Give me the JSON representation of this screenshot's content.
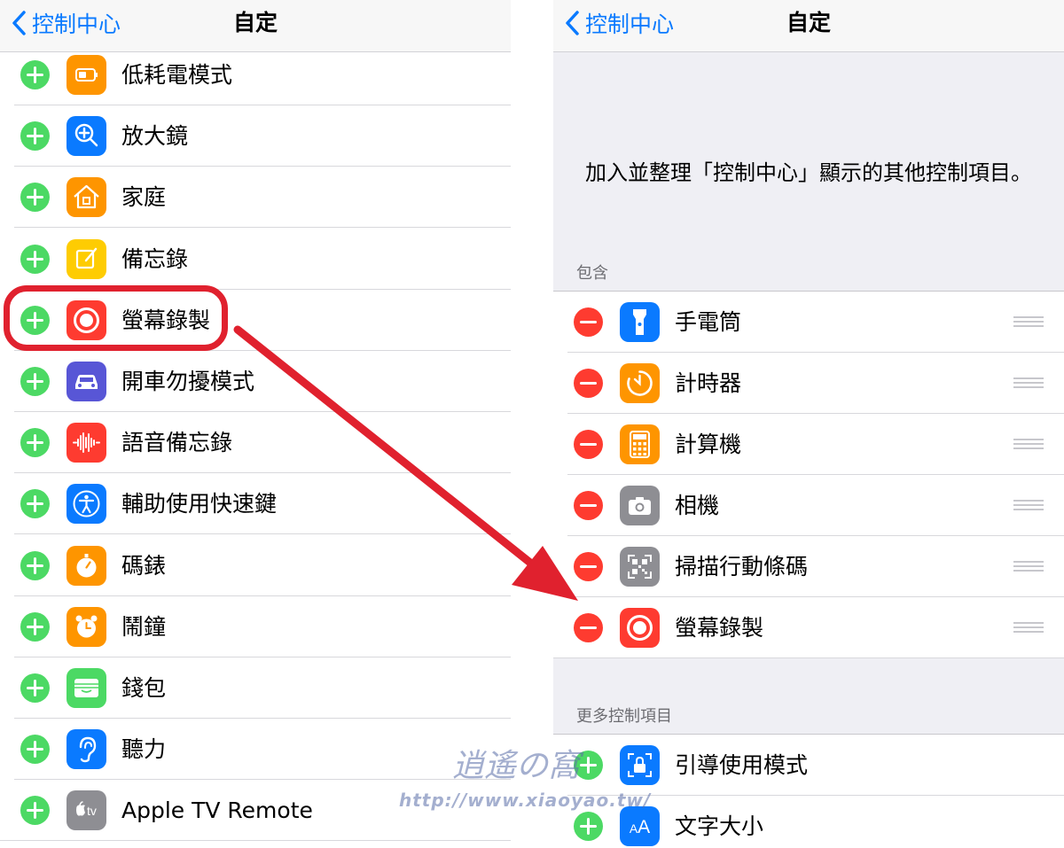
{
  "left": {
    "back_label": "控制中心",
    "title": "自定",
    "items": [
      {
        "label": "低耗電模式",
        "icon": "battery-icon",
        "color": "#fe9500"
      },
      {
        "label": "放大鏡",
        "icon": "magnifier-icon",
        "color": "#0a7aff"
      },
      {
        "label": "家庭",
        "icon": "home-icon",
        "color": "#fe9500"
      },
      {
        "label": "備忘錄",
        "icon": "notes-icon",
        "color": "#fecc02"
      },
      {
        "label": "螢幕錄製",
        "icon": "screen-record-icon",
        "color": "#fe3b30"
      },
      {
        "label": "開車勿擾模式",
        "icon": "car-icon",
        "color": "#5856d6"
      },
      {
        "label": "語音備忘錄",
        "icon": "voice-memo-icon",
        "color": "#fe3b30"
      },
      {
        "label": "輔助使用快速鍵",
        "icon": "accessibility-icon",
        "color": "#0a7aff"
      },
      {
        "label": "碼錶",
        "icon": "stopwatch-icon",
        "color": "#fe9500"
      },
      {
        "label": "鬧鐘",
        "icon": "alarm-icon",
        "color": "#fe9500"
      },
      {
        "label": "錢包",
        "icon": "wallet-icon",
        "color": "#4cd964"
      },
      {
        "label": "聽力",
        "icon": "ear-icon",
        "color": "#0a7aff"
      },
      {
        "label": "Apple TV Remote",
        "icon": "apple-tv-icon",
        "color": "#8e8e93",
        "icon_text": "tv"
      }
    ]
  },
  "right": {
    "back_label": "控制中心",
    "title": "自定",
    "description": "加入並整理「控制中心」顯示的其他控制項目。",
    "included_header": "包含",
    "included": [
      {
        "label": "手電筒",
        "icon": "flashlight-icon",
        "color": "#0a7aff"
      },
      {
        "label": "計時器",
        "icon": "timer-icon",
        "color": "#fe9500"
      },
      {
        "label": "計算機",
        "icon": "calculator-icon",
        "color": "#fe9500"
      },
      {
        "label": "相機",
        "icon": "camera-icon",
        "color": "#8e8e93"
      },
      {
        "label": "掃描行動條碼",
        "icon": "qr-code-icon",
        "color": "#8e8e93"
      },
      {
        "label": "螢幕錄製",
        "icon": "screen-record-icon",
        "color": "#fe3b30"
      }
    ],
    "more_header": "更多控制項目",
    "more": [
      {
        "label": "引導使用模式",
        "icon": "guided-access-icon",
        "color": "#0a7aff"
      },
      {
        "label": "文字大小",
        "icon": "text-size-icon",
        "color": "#0a7aff",
        "icon_text": "AA"
      }
    ]
  },
  "watermark": {
    "title": "逍遙の窩",
    "url": "http://www.xiaoyao.tw/"
  }
}
